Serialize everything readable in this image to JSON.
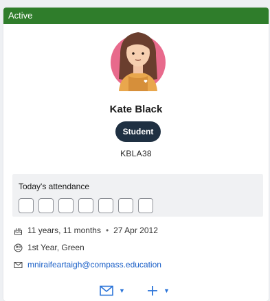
{
  "status": {
    "label": "Active",
    "color": "#2f7d2b"
  },
  "profile": {
    "name": "Kate Black",
    "role": "Student",
    "code": "KBLA38"
  },
  "attendance": {
    "title": "Today's attendance",
    "slots": 7
  },
  "details": {
    "age": "11 years, 11 months",
    "separator": "•",
    "dob": "27 Apr 2012",
    "year_group": "1st Year, Green",
    "email": "mniraifeartaigh@compass.education"
  },
  "actions": {
    "mail_icon": "mail-icon",
    "add_icon": "plus-icon",
    "accent": "#2a73d8"
  }
}
